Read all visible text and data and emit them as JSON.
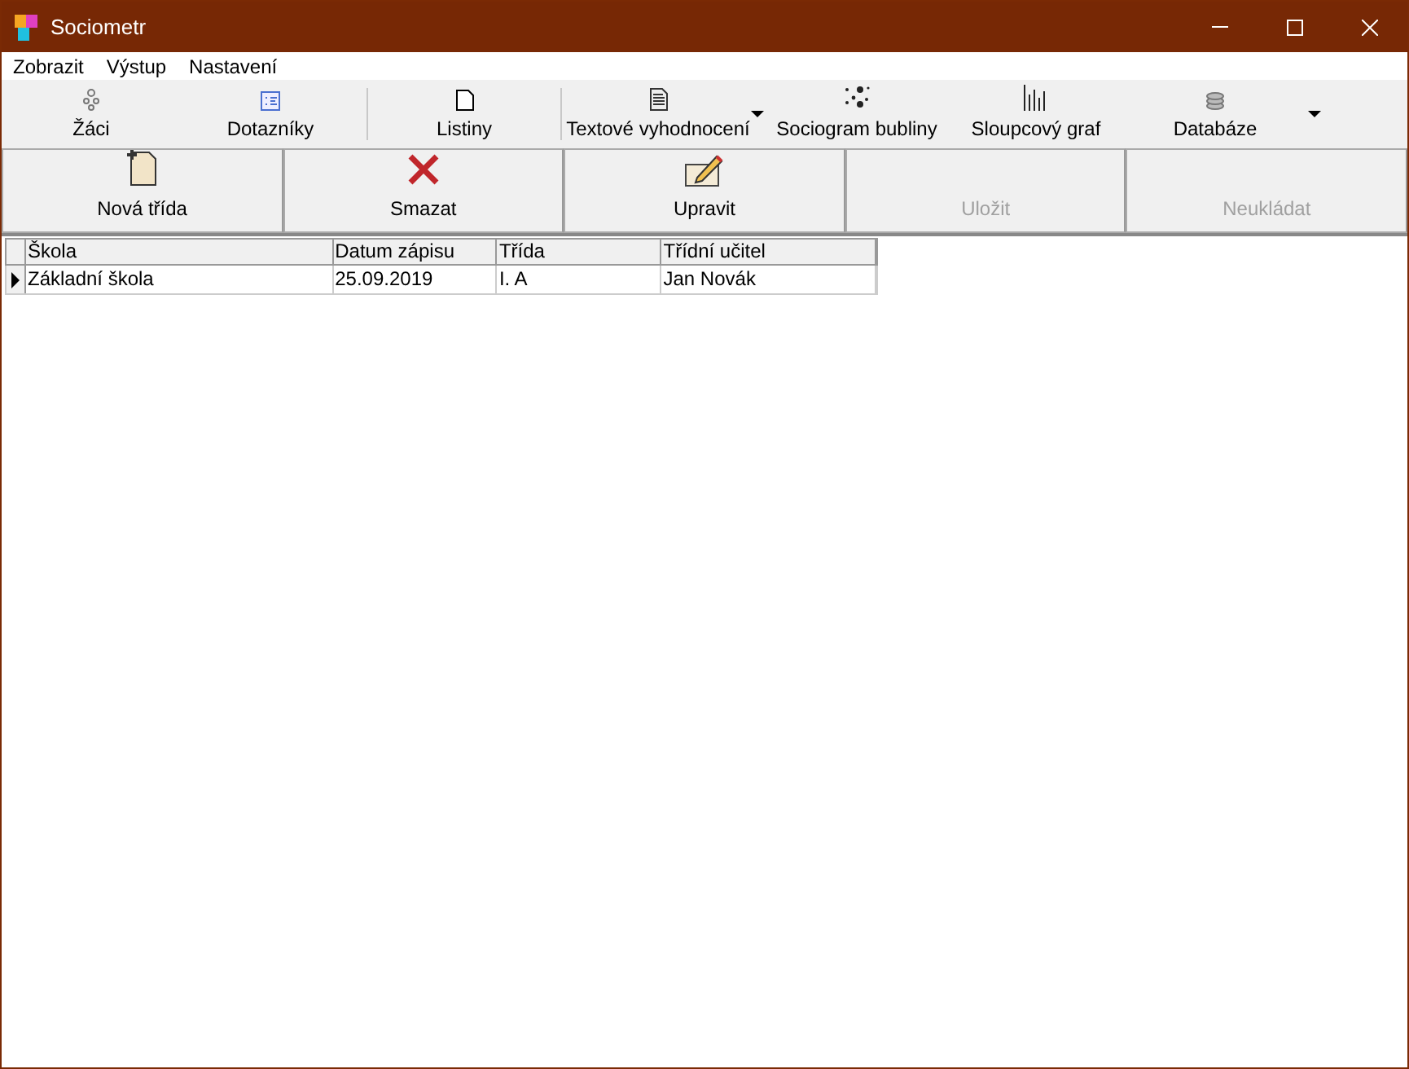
{
  "window": {
    "title": "Sociometr"
  },
  "menu": [
    "Zobrazit",
    "Výstup",
    "Nastavení"
  ],
  "toolbar": [
    {
      "kind": "button",
      "label": "Žáci"
    },
    {
      "kind": "button",
      "label": "Dotazníky"
    },
    {
      "kind": "separator"
    },
    {
      "kind": "button",
      "label": "Listiny"
    },
    {
      "kind": "separator"
    },
    {
      "kind": "button",
      "label": "Textové vyhodnocení"
    },
    {
      "kind": "dropdown"
    },
    {
      "kind": "button",
      "label": "Sociogram bubliny"
    },
    {
      "kind": "button",
      "label": "Sloupcový graf"
    },
    {
      "kind": "button",
      "label": "Databáze"
    },
    {
      "kind": "dropdown"
    }
  ],
  "actions": [
    {
      "label": "Nová třída",
      "disabled": false
    },
    {
      "label": "Smazat",
      "disabled": false
    },
    {
      "label": "Upravit",
      "disabled": false
    },
    {
      "label": "Uložit",
      "disabled": true
    },
    {
      "label": "Neukládat",
      "disabled": true
    }
  ],
  "table": {
    "columns": [
      "Škola",
      "Datum zápisu",
      "Třída",
      "Třídní učitel"
    ],
    "rows": [
      {
        "selected": true,
        "cells": [
          "Základní škola",
          "25.09.2019",
          "I. A",
          "Jan Novák"
        ]
      }
    ]
  }
}
